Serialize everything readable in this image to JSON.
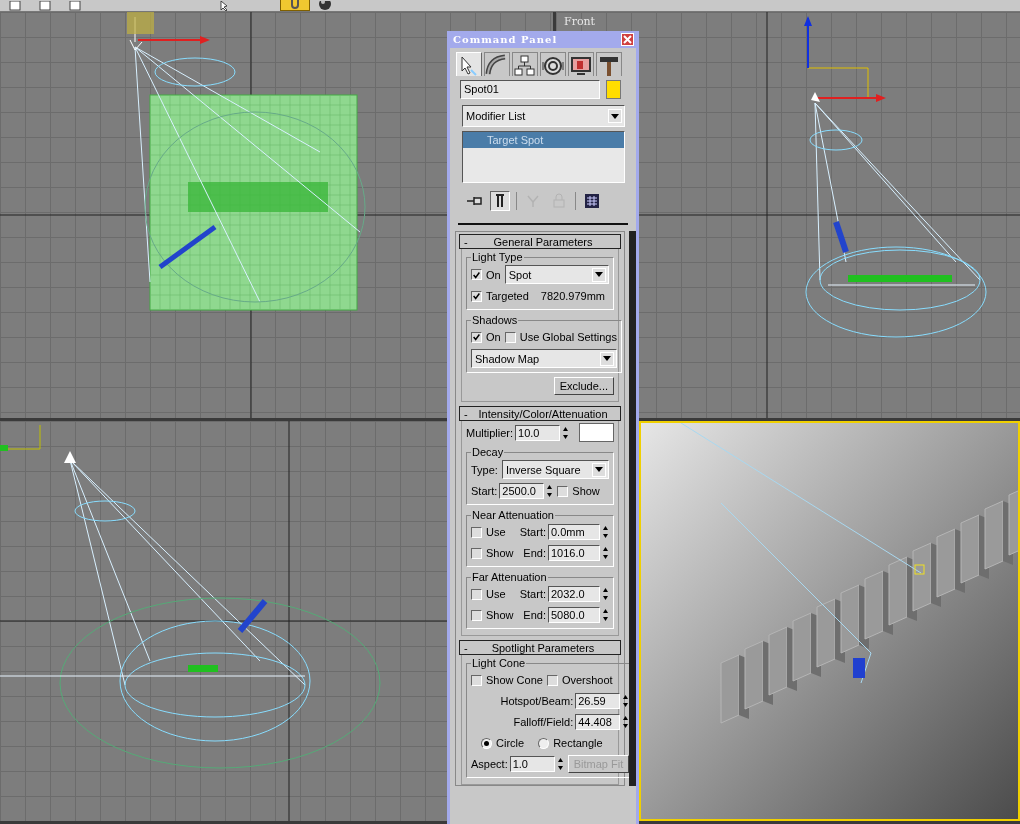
{
  "toolbar": {
    "tools": [
      {
        "selected": false
      },
      {
        "selected": false
      },
      {
        "selected": false
      },
      {
        "selected": false
      },
      {
        "selected": true
      },
      {
        "selected": false
      }
    ]
  },
  "viewports": [
    {
      "active": false
    },
    {
      "label": "Front",
      "active": false
    },
    {
      "active": false
    },
    {
      "active": true
    }
  ],
  "command_panel": {
    "title": "Command Panel",
    "tabs": [
      {
        "selected": true
      },
      {
        "selected": false
      },
      {
        "selected": false
      },
      {
        "selected": false
      },
      {
        "selected": false
      },
      {
        "selected": false
      }
    ],
    "object_name": "Spot01",
    "modifier_list": "Modifier List",
    "stack": [
      {
        "label": "Target Spot",
        "selected": true
      }
    ],
    "stack_tools": [
      {
        "on": false,
        "disabled": false
      },
      {
        "on": true,
        "disabled": false
      },
      {
        "on": false,
        "disabled": true
      },
      {
        "on": false,
        "disabled": true
      },
      {
        "on": false,
        "disabled": false
      }
    ],
    "rollouts": [
      {
        "sign": "-",
        "title": "General Parameters",
        "expanded": true,
        "sections": [
          {
            "kind": "group",
            "title": "Light Type",
            "rows": [
              {
                "controls": [
                  {
                    "kind": "checkbox",
                    "label": "On",
                    "checked": true
                  },
                  {
                    "kind": "dropdown",
                    "value": "Spot"
                  }
                ]
              },
              {
                "controls": [
                  {
                    "kind": "checkbox",
                    "label": "Targeted",
                    "checked": true
                  },
                  {
                    "kind": "text",
                    "text": "7820.979mm"
                  }
                ]
              }
            ]
          },
          {
            "kind": "group",
            "title": "Shadows",
            "rows": [
              {
                "controls": [
                  {
                    "kind": "checkbox",
                    "label": "On",
                    "checked": true
                  },
                  {
                    "kind": "checkbox",
                    "label": "Use Global Settings",
                    "checked": false
                  }
                ]
              },
              {
                "controls": [
                  {
                    "kind": "dropdown",
                    "value": "Shadow Map"
                  }
                ]
              }
            ]
          },
          {
            "kind": "row",
            "controls": [
              {
                "kind": "button",
                "label": "Exclude...",
                "disabled": false
              }
            ]
          }
        ]
      },
      {
        "sign": "-",
        "title": "Intensity/Color/Attenuation",
        "expanded": true,
        "sections": [
          {
            "kind": "row",
            "controls": [
              {
                "kind": "spinner",
                "label": "Multiplier:",
                "value": "10.0"
              },
              {
                "kind": "swatch"
              }
            ]
          },
          {
            "kind": "group",
            "title": "Decay",
            "rows": [
              {
                "controls": [
                  {
                    "kind": "text",
                    "text": "Type:"
                  },
                  {
                    "kind": "dropdown",
                    "value": "Inverse Square"
                  }
                ]
              },
              {
                "controls": [
                  {
                    "kind": "spinner",
                    "label": "Start:",
                    "value": "2500.0"
                  },
                  {
                    "kind": "checkbox",
                    "label": "Show",
                    "checked": false
                  }
                ]
              }
            ]
          },
          {
            "kind": "group",
            "title": "Near Attenuation",
            "rows": [
              {
                "controls": [
                  {
                    "kind": "checkbox",
                    "label": "Use",
                    "checked": false
                  },
                  {
                    "kind": "spinner",
                    "label": "Start:",
                    "value": "0.0mm"
                  }
                ]
              },
              {
                "controls": [
                  {
                    "kind": "checkbox",
                    "label": "Show",
                    "checked": false
                  },
                  {
                    "kind": "spinner",
                    "label": "End:",
                    "value": "1016.0"
                  }
                ]
              }
            ]
          },
          {
            "kind": "group",
            "title": "Far Attenuation",
            "rows": [
              {
                "controls": [
                  {
                    "kind": "checkbox",
                    "label": "Use",
                    "checked": false
                  },
                  {
                    "kind": "spinner",
                    "label": "Start:",
                    "value": "2032.0"
                  }
                ]
              },
              {
                "controls": [
                  {
                    "kind": "checkbox",
                    "label": "Show",
                    "checked": false
                  },
                  {
                    "kind": "spinner",
                    "label": "End:",
                    "value": "5080.0"
                  }
                ]
              }
            ]
          }
        ]
      },
      {
        "sign": "-",
        "title": "Spotlight Parameters",
        "expanded": true,
        "sections": [
          {
            "kind": "group",
            "title": "Light Cone",
            "rows": [
              {
                "controls": [
                  {
                    "kind": "checkbox",
                    "label": "Show Cone",
                    "checked": false
                  },
                  {
                    "kind": "checkbox",
                    "label": "Overshoot",
                    "checked": false
                  }
                ]
              },
              {
                "controls": [
                  {
                    "kind": "spinner",
                    "label": "Hotspot/Beam:",
                    "value": "26.59"
                  }
                ]
              },
              {
                "controls": [
                  {
                    "kind": "spinner",
                    "label": "Falloff/Field:",
                    "value": "44.408"
                  }
                ]
              },
              {
                "controls": [
                  {
                    "kind": "radio",
                    "label": "Circle",
                    "selected": true
                  },
                  {
                    "kind": "radio",
                    "label": "Rectangle",
                    "selected": false
                  }
                ]
              },
              {
                "controls": [
                  {
                    "kind": "spinner",
                    "label": "Aspect:",
                    "value": "1.0"
                  },
                  {
                    "kind": "button",
                    "label": "Bitmap Fit",
                    "disabled": true
                  }
                ]
              }
            ]
          }
        ]
      }
    ]
  }
}
